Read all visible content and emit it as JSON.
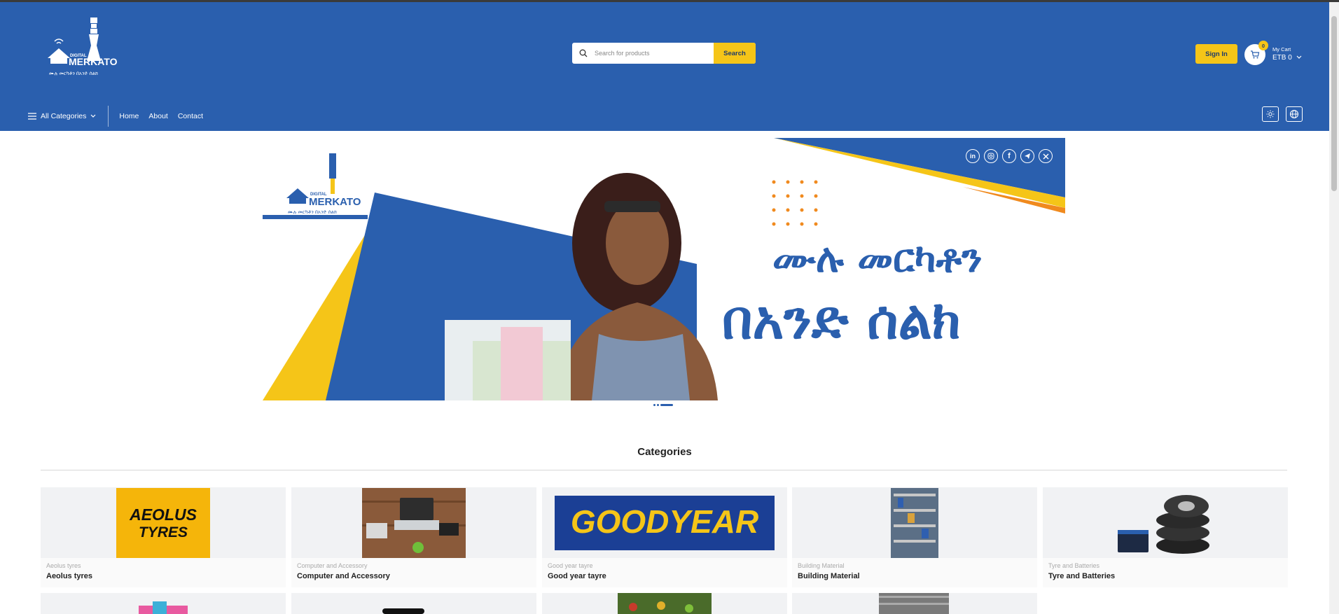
{
  "header": {
    "logo_text": "DIGITAL MERKATO",
    "search_placeholder": "Search for products",
    "search_button": "Search",
    "signin_label": "Sign In",
    "cart": {
      "count": "0",
      "label": "My Cart",
      "total": "ETB 0"
    }
  },
  "nav": {
    "all_categories": "All Categories",
    "links": [
      "Home",
      "About",
      "Contact"
    ]
  },
  "banner": {
    "logo_text": "DIGITAL MERKATO",
    "social": [
      "linkedin",
      "instagram",
      "facebook",
      "telegram",
      "x"
    ],
    "headline_line1": "ሙሉ መርካቶን",
    "headline_line2": "በአንድ ሰልክ"
  },
  "categories": {
    "title": "Categories",
    "items": [
      {
        "sub": "Aeolus tyres",
        "name": "Aeolus tyres"
      },
      {
        "sub": "Computer and Accessory",
        "name": "Computer and Accessory"
      },
      {
        "sub": "Good year tayre",
        "name": "Good year tayre"
      },
      {
        "sub": "Building Material",
        "name": "Building Material"
      },
      {
        "sub": "Tyre and Batteries",
        "name": "Tyre and Batteries"
      }
    ]
  },
  "colors": {
    "primary": "#2a5fae",
    "accent": "#f5c518"
  }
}
